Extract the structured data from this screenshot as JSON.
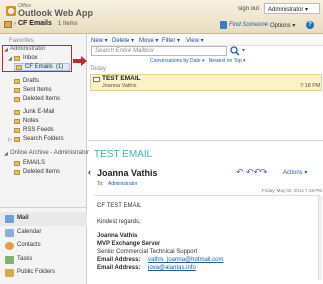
{
  "app": {
    "logo_small": "Office",
    "logo_main": "Outlook Web App",
    "sign_out": "sign out",
    "user": "Administrator",
    "options": "Options",
    "find_someone": "Find Someone"
  },
  "breadcrumb": {
    "folder": "CF Emails",
    "count": "1 Items"
  },
  "nav": {
    "favorites": "Favorites",
    "mailbox_root": "Administrator",
    "inbox": "Inbox",
    "selected_folder": "CF Emails",
    "selected_count": "(1)",
    "folders": [
      "Drafts",
      "Sent Items",
      "Deleted Items",
      "Junk E-Mail",
      "Notes",
      "RSS Feeds",
      "Search Folders"
    ],
    "archive_root": "Online Archive - Administrator",
    "archive_folders": [
      "EMAILS",
      "Deleted Items"
    ],
    "modules": [
      "Mail",
      "Calendar",
      "Contacts",
      "Tasks",
      "Public Folders"
    ]
  },
  "toolbar": {
    "new": "New",
    "delete": "Delete",
    "move": "Move",
    "filter": "Filter",
    "view": "View"
  },
  "search": {
    "placeholder": "Search Entire Mailbox"
  },
  "list": {
    "sort_conversations": "Conversations by Date",
    "sort_newest": "Newest on Top",
    "group_label": "Today",
    "messages": [
      {
        "subject": "TEST EMAIL",
        "from": "Joanna Vathis",
        "time": "7:18 PM"
      }
    ]
  },
  "reading": {
    "subject": "TEST EMAIL",
    "from": "Joanna Vathis",
    "to_label": "To:",
    "to": "Administrator",
    "date": "Friday, May 02, 2012 7:18 PM",
    "actions": "Actions",
    "body_lines": [
      "CF TEST EMAIL",
      "Kindest regards,",
      "Joanna Vathis",
      "MVP Exchange Server",
      "Senior  Commercial Technical Support"
    ],
    "email_label": "Email Address:",
    "email_1": "vathis_joanna@hotmail.com",
    "email_2": "jova@alantas.info"
  },
  "colors": {
    "highlight_box": "#c3262e",
    "subject_teal": "#3fb5b0",
    "selected_row": "#fcf2c6",
    "link_blue": "#1f5fa8"
  }
}
